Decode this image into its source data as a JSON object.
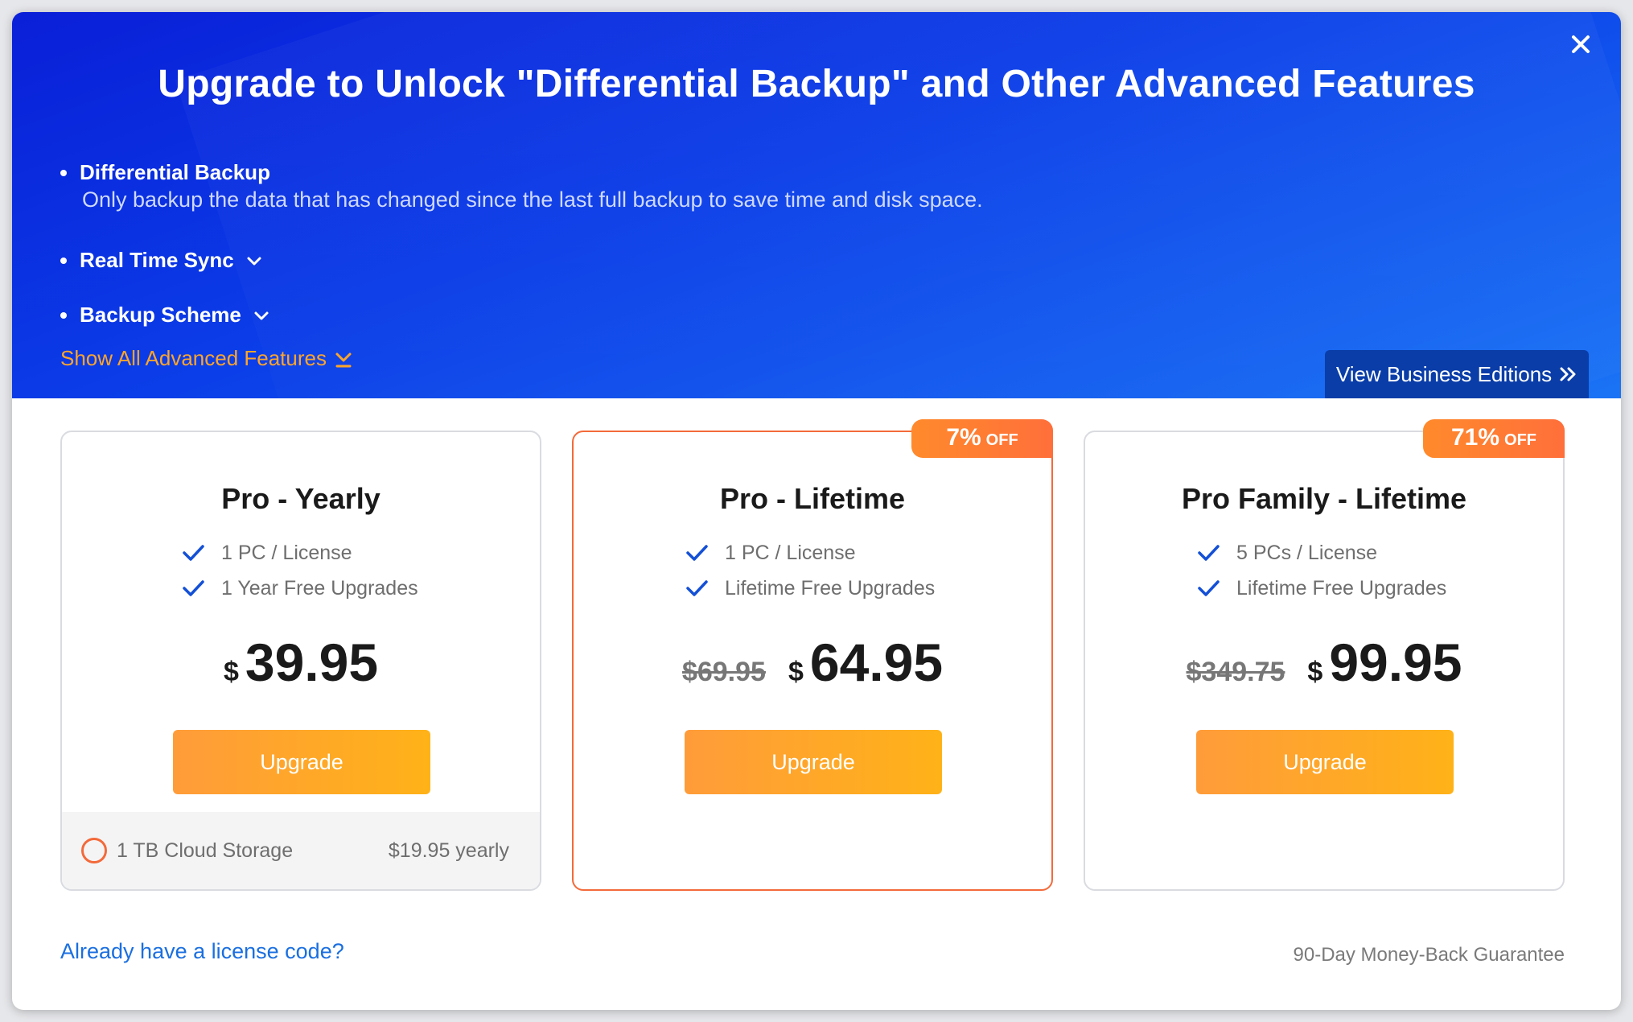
{
  "header": {
    "title": "Upgrade to Unlock \"Differential Backup\" and Other Advanced Features",
    "close_icon": "close-icon"
  },
  "features": [
    {
      "name": "Differential Backup",
      "description": "Only backup the data that has changed since the last full backup to save time and disk space.",
      "expanded": true
    },
    {
      "name": "Real Time Sync",
      "expanded": false
    },
    {
      "name": "Backup Scheme",
      "expanded": false
    }
  ],
  "show_all_label": "Show All Advanced Features",
  "business_button_label": "View Business Editions",
  "plans": [
    {
      "title": "Pro - Yearly",
      "items": [
        "1 PC / License",
        "1 Year Free Upgrades"
      ],
      "currency": "$",
      "price": "39.95",
      "upgrade_label": "Upgrade",
      "addon": {
        "label": "1 TB Cloud Storage",
        "price": "$19.95 yearly"
      }
    },
    {
      "title": "Pro - Lifetime",
      "items": [
        "1 PC / License",
        "Lifetime Free Upgrades"
      ],
      "badge_pct": "7%",
      "badge_off": "OFF",
      "old_price": "$69.95",
      "currency": "$",
      "price": "64.95",
      "upgrade_label": "Upgrade"
    },
    {
      "title": "Pro Family - Lifetime",
      "items": [
        "5 PCs / License",
        "Lifetime Free Upgrades"
      ],
      "badge_pct": "71%",
      "badge_off": "OFF",
      "old_price": "$349.75",
      "currency": "$",
      "price": "99.95",
      "upgrade_label": "Upgrade"
    }
  ],
  "footer": {
    "license_link": "Already have a license code?",
    "guarantee": "90-Day Money-Back Guarantee"
  },
  "colors": {
    "hero_blue": "#0b3ee8",
    "accent_orange": "#ffa52a",
    "badge_orange": "#ff7a32",
    "link_blue": "#1a6fe0",
    "check_blue": "#1450d6"
  }
}
